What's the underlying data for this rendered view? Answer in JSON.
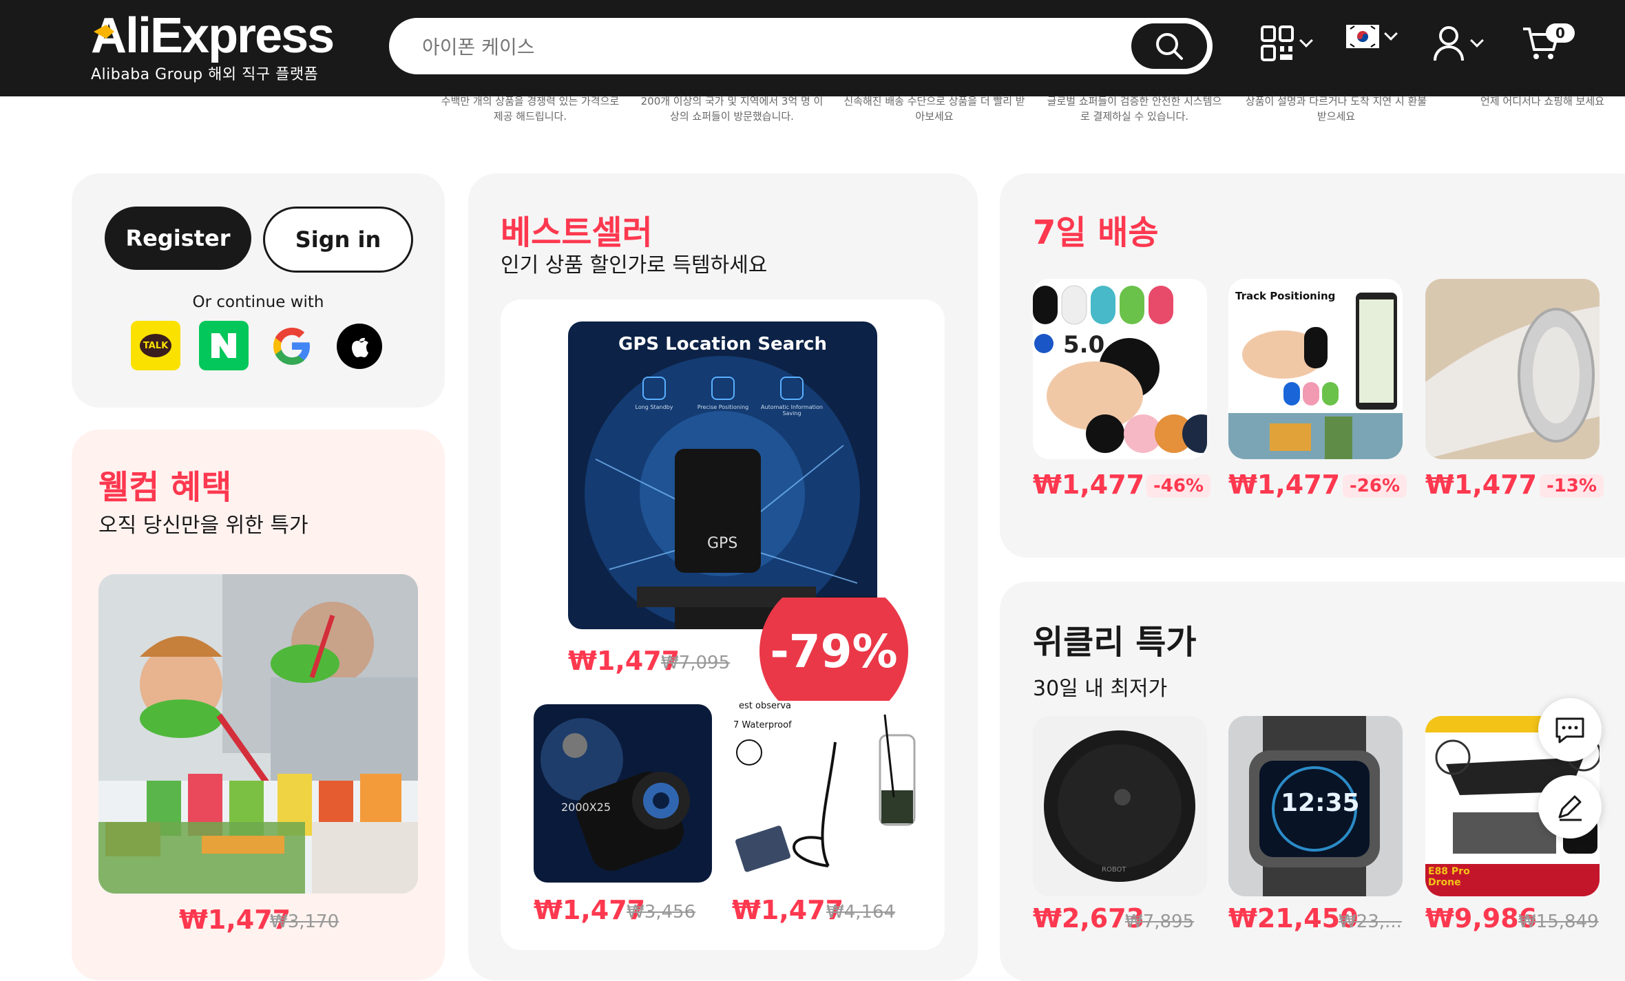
{
  "header": {
    "logo_text": "AliExpress",
    "logo_sub": "Alibaba Group 해외 직구 플랫폼",
    "search_placeholder": "아이폰 케이스",
    "cart_count": "0"
  },
  "strip": [
    "수백만 개의 상품을 경쟁력 있는 가격으로 제공 해드립니다.",
    "200개 이상의 국가 및 지역에서 3억 명 이상의 쇼퍼들이 방문했습니다.",
    "신속해진 배송 수단으로 상품을 더 빨리 받아보세요",
    "글로벌 쇼퍼들이 검증한 안전한 시스템으로 결제하실 수 있습니다.",
    "상품이 설명과 다르거나 도착 지연 시 환불받으세요",
    "언제 어디서나 쇼핑해 보세요"
  ],
  "login": {
    "register": "Register",
    "signin": "Sign in",
    "or_continue": "Or continue with",
    "kakao_label": "TALK"
  },
  "welcome": {
    "title": "웰컴 혜택",
    "subtitle": "오직 당신만을 위한 특가",
    "price": "₩1,477",
    "orig": "₩3,170"
  },
  "bestseller": {
    "title": "베스트셀러",
    "subtitle": "인기 상품 할인가로 득템하세요",
    "main_img_title": "GPS Location Search",
    "main_img_icons": [
      "Long Standby",
      "Precise Positioning",
      "Automatic Information Saving"
    ],
    "main_img_device": "GPS",
    "main_price": "₩1,477",
    "main_orig": "₩7,095",
    "badge": "-79%",
    "item2_price": "₩1,477",
    "item2_orig": "₩3,456",
    "item2_img_text": "2000X25",
    "item3_price": "₩1,477",
    "item3_orig": "₩4,164",
    "item3_img_text1": "est observa",
    "item3_img_text2": "7 Waterproof"
  },
  "delivery": {
    "title": "7일 배송",
    "items": [
      {
        "price": "₩1,477",
        "discount": "-46%",
        "img_text": "5.0"
      },
      {
        "price": "₩1,477",
        "discount": "-26%",
        "img_text": "Track Positioning"
      },
      {
        "price": "₩1,477",
        "discount": "-13%",
        "img_text": ""
      }
    ]
  },
  "weekly": {
    "title": "위클리 특가",
    "subtitle": "30일 내 최저가",
    "items": [
      {
        "price": "₩2,673",
        "orig": "₩7,895",
        "img_text": "ROBOT"
      },
      {
        "price": "₩21,450",
        "orig": "₩23,...",
        "img_text": "12:35"
      },
      {
        "price": "₩9,986",
        "orig": "₩15,849",
        "img_text": "E88 Pro Drone"
      }
    ]
  },
  "colors": {
    "brand_red": "#fd384f",
    "dark": "#191919",
    "kakao": "#fae100",
    "naver": "#03c75a"
  }
}
